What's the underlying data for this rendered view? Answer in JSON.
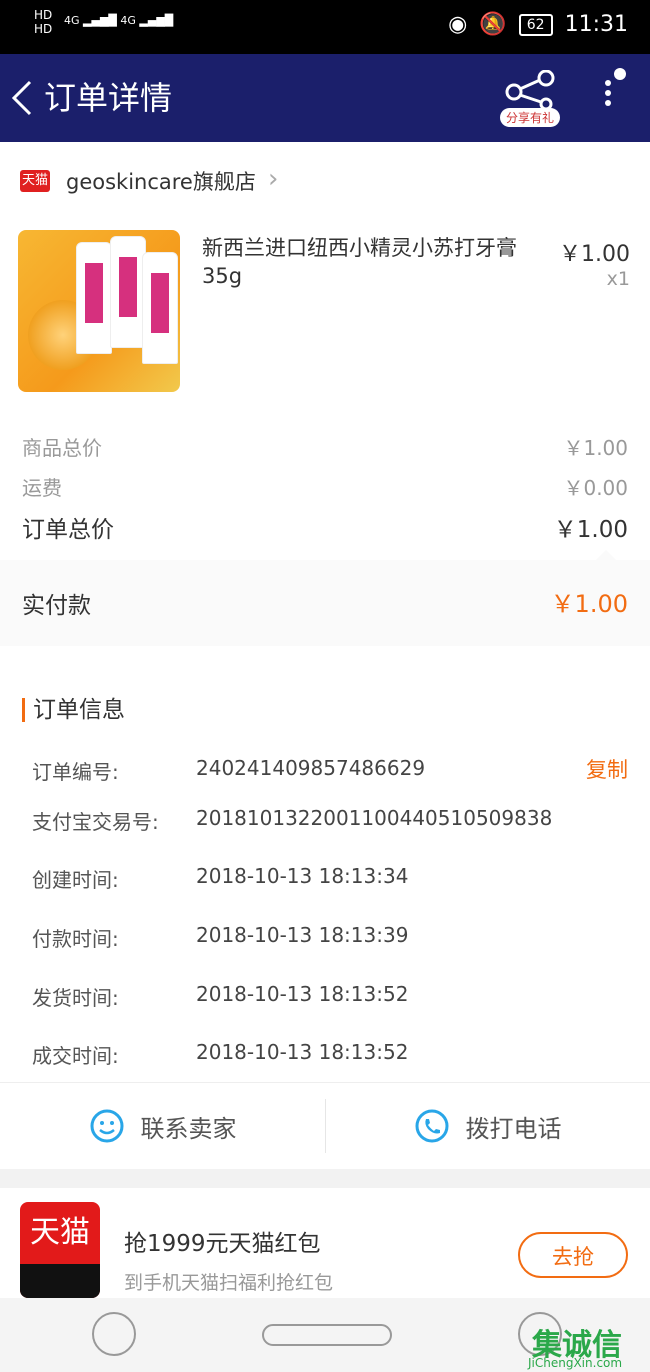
{
  "status": {
    "net1": "4G",
    "net2": "4G",
    "hd1": "HD",
    "hd2": "HD",
    "battery": "62",
    "time": "11:31"
  },
  "header": {
    "back_icon": "chevron-left-icon",
    "title": "订单详情",
    "share_badge": "分享有礼"
  },
  "shop": {
    "logo_text": "天猫",
    "name": "geoskincare旗舰店",
    "chevron": "›"
  },
  "product": {
    "name": "新西兰进口纽西小精灵小苏打牙膏35g",
    "price": "￥1.00",
    "qty": "x1"
  },
  "price_summary": {
    "goods_total_label": "商品总价",
    "goods_total": "￥1.00",
    "shipping_label": "运费",
    "shipping": "￥0.00",
    "order_total_label": "订单总价",
    "order_total": "￥1.00",
    "paid_label": "实付款",
    "paid_value": "￥1.00"
  },
  "order_info": {
    "section_title": "订单信息",
    "copy_label": "复制",
    "rows": [
      {
        "label": "订单编号:",
        "value": "240241409857486629"
      },
      {
        "label": "支付宝交易号:",
        "value": "2018101322001100440510509838"
      },
      {
        "label": "创建时间:",
        "value": "2018-10-13 18:13:34"
      },
      {
        "label": "付款时间:",
        "value": "2018-10-13 18:13:39"
      },
      {
        "label": "发货时间:",
        "value": "2018-10-13 18:13:52"
      },
      {
        "label": "成交时间:",
        "value": "2018-10-13 18:13:52"
      }
    ]
  },
  "actions": {
    "contact_seller": "联系卖家",
    "call": "拨打电话"
  },
  "promo": {
    "app_text": "天猫",
    "title": "抢1999元天猫红包",
    "subtitle": "到手机天猫扫福利抢红包",
    "button": "去抢"
  },
  "watermark": {
    "text": "集诚信",
    "sub": "JiChengXin.com"
  },
  "colors": {
    "accent": "#f26c12",
    "appbar": "#1b1f6b",
    "icon_blue": "#29a6e8"
  }
}
